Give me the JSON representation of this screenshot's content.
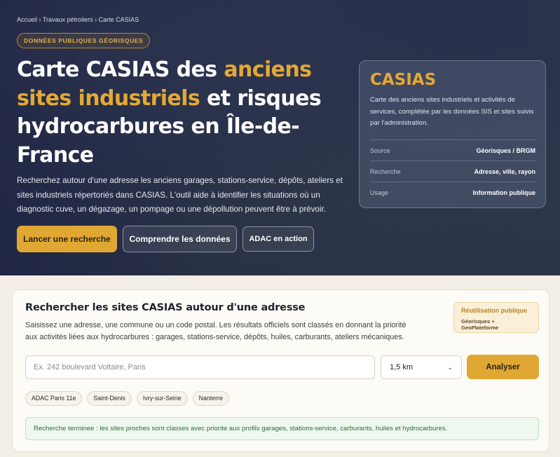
{
  "breadcrumb": {
    "items": [
      "Accueil",
      "Travaux pétroliers",
      "Carte CASIAS"
    ],
    "separator": "›"
  },
  "hero": {
    "badge": "DONNÉES PUBLIQUES GÉORISQUES",
    "title_part1": "Carte CASIAS des ",
    "title_accent": "anciens sites industriels",
    "title_part2": " et risques hydrocarbures en Île-de-France",
    "description": "Recherchez autour d'une adresse les anciens garages, stations-service, dépôts, ateliers et sites industriels répertoriés dans CASIAS. L'outil aide à identifier les situations où un diagnostic cuve, un dégazage, un pompage ou une dépollution peuvent être à prévoir.",
    "buttons": {
      "primary": "Lancer une recherche",
      "secondary": "Comprendre les données",
      "tertiary": "ADAC en action"
    }
  },
  "info_card": {
    "title": "CASIAS",
    "description": "Carte des anciens sites industriels et activités de services, complétée par les données SIS et sites suivis par l'administration.",
    "rows": [
      {
        "key": "Source",
        "value": "Géorisques / BRGM"
      },
      {
        "key": "Recherche",
        "value": "Adresse, ville, rayon"
      },
      {
        "key": "Usage",
        "value": "Information publique"
      }
    ]
  },
  "search_panel": {
    "title": "Rechercher les sites CASIAS autour d'une adresse",
    "description": "Saisissez une adresse, une commune ou un code postal. Les résultats officiels sont classés en donnant la priorité aux activités liées aux hydrocarbures : garages, stations-service, dépôts, huiles, carburants, ateliers mécaniques.",
    "reuse_title": "Réutilisation publique",
    "reuse_subtitle": "Géorisques + GeoPlateforme",
    "address_value": "",
    "address_placeholder": "Ex. 242 boulevard Voltaire, Paris",
    "radius_selected": "1,5 km",
    "analyze_label": "Analyser",
    "chips": [
      "ADAC Paris 11e",
      "Saint-Denis",
      "Ivry-sur-Seine",
      "Nanterre"
    ],
    "status_message": "Recherche terminee : les sites proches sont classes avec priorite aux profils garages, stations-service, carburants, huiles et hydrocarbures."
  },
  "colors": {
    "accent": "#e0a832",
    "hero_background": "#2a3250",
    "status_background": "#eef8ef",
    "status_text": "#2e6b39"
  }
}
